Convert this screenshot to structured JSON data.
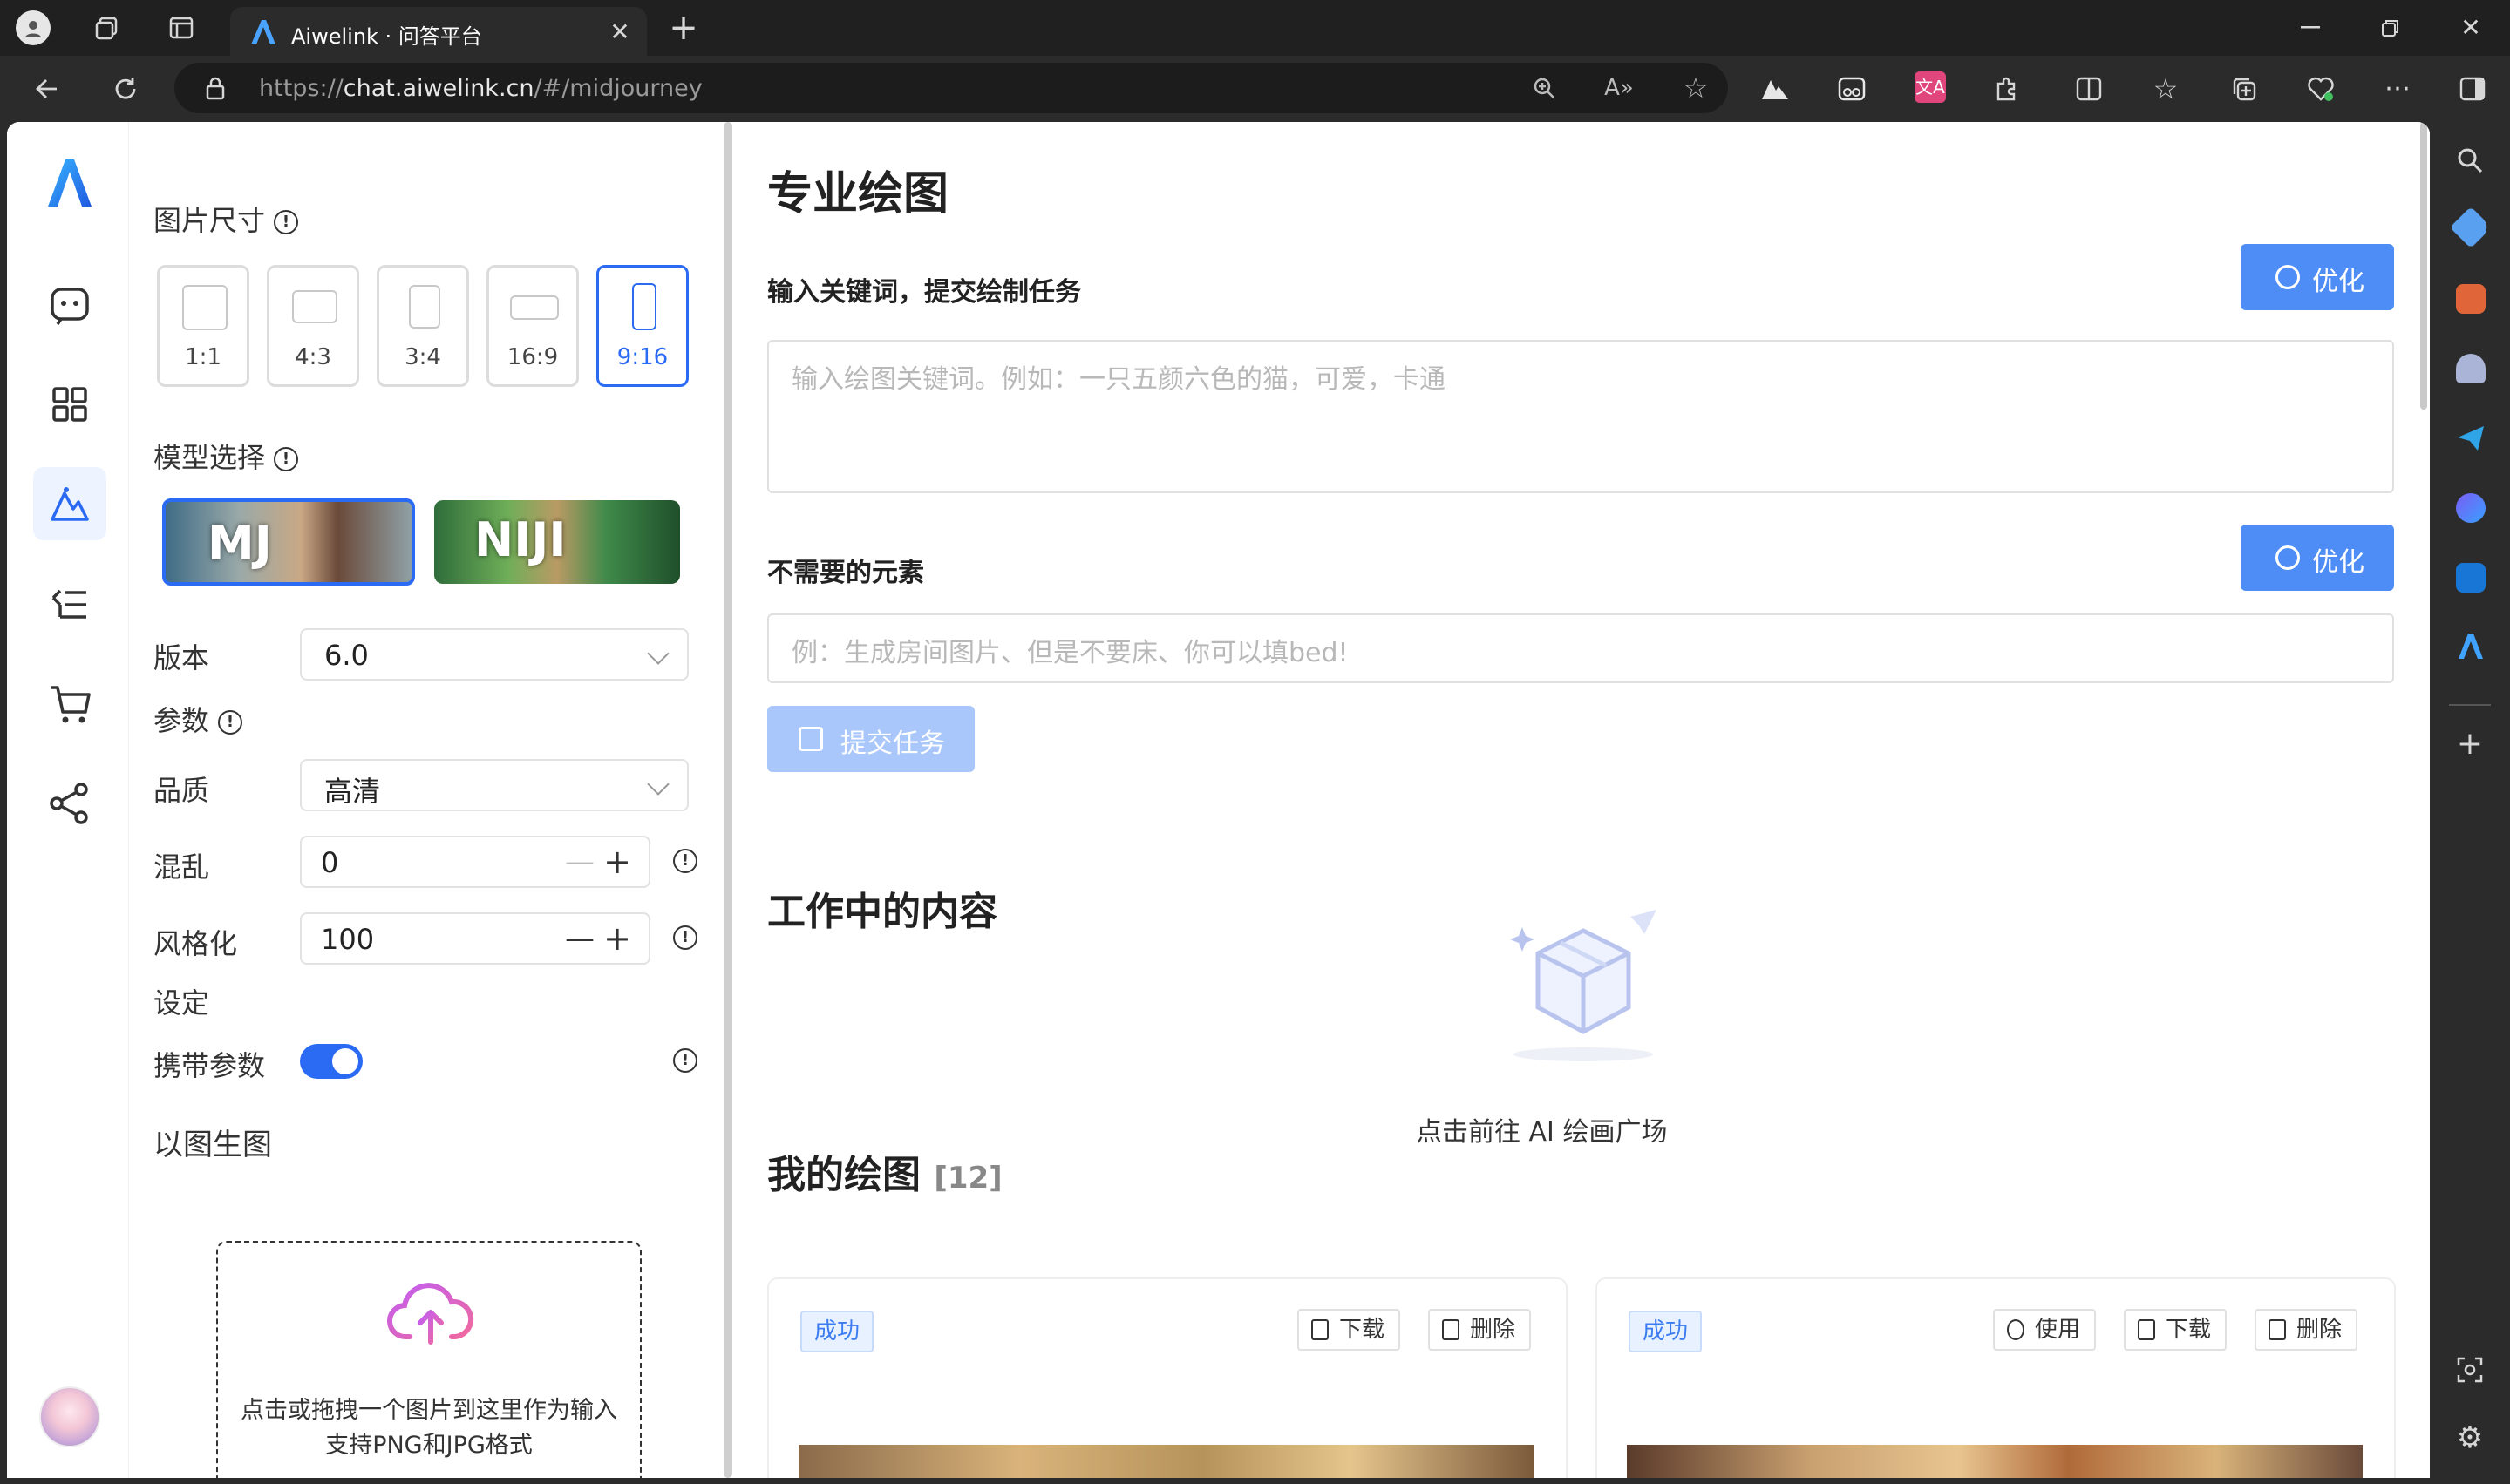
{
  "browser": {
    "tab_title": "Aiwelink · 问答平台",
    "url_prefix": "https://",
    "url_host": "chat.aiwelink.cn",
    "url_path": "/#/midjourney"
  },
  "settings": {
    "image_size_label": "图片尺寸",
    "ratios": [
      "1:1",
      "4:3",
      "3:4",
      "16:9",
      "9:16"
    ],
    "selected_ratio": "9:16",
    "model_label": "模型选择",
    "models": [
      "MJ",
      "NIJI"
    ],
    "selected_model": "MJ",
    "version_label": "版本",
    "version_value": "6.0",
    "params_label": "参数",
    "quality_label": "品质",
    "quality_value": "高清",
    "chaos_label": "混乱",
    "chaos_value": "0",
    "stylize_label": "风格化",
    "stylize_value": "100",
    "config_label": "设定",
    "carry_params_label": "携带参数",
    "carry_params_on": true,
    "img2img_label": "以图生图",
    "upload_line1": "点击或拖拽一个图片到这里作为输入",
    "upload_line2": "支持PNG和JPG格式"
  },
  "main": {
    "title": "专业绘图",
    "prompt_label": "输入关键词，提交绘制任务",
    "optimize_label": "优化",
    "prompt_placeholder": "输入绘图关键词。例如：一只五颜六色的猫，可爱，卡通",
    "negative_label": "不需要的元素",
    "negative_placeholder": "例：生成房间图片、但是不要床、你可以填bed!",
    "submit_label": "提交任务",
    "working_title": "工作中的内容",
    "empty_text": "点击前往 AI 绘画广场",
    "my_drawings_title": "我的绘图",
    "my_drawings_count": "[12]",
    "cards": [
      {
        "status": "成功",
        "actions": [
          "下载",
          "删除"
        ]
      },
      {
        "status": "成功",
        "actions": [
          "使用",
          "下载",
          "删除"
        ]
      }
    ]
  },
  "colors": {
    "accent": "#2b6af3",
    "button": "#4f8df6",
    "button_disabled": "#a9c7fb"
  }
}
